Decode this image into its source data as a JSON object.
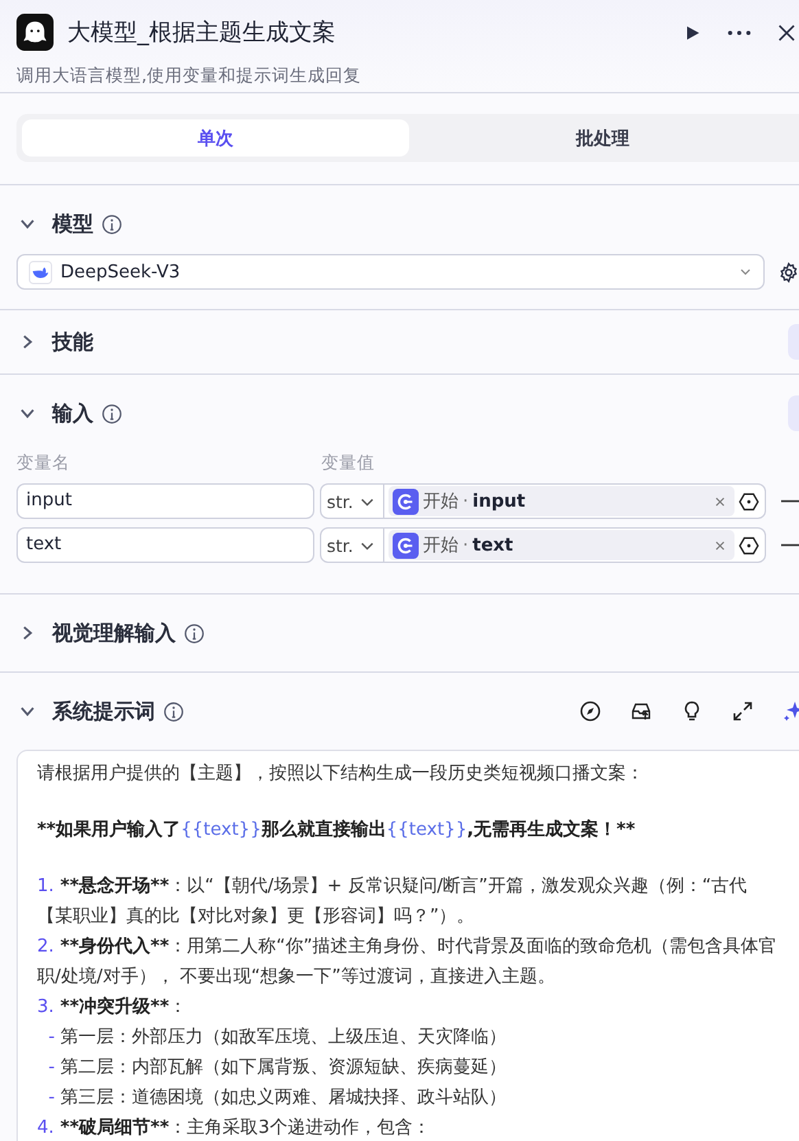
{
  "header": {
    "title": "大模型_根据主题生成文案",
    "subtitle": "调用大语言模型,使用变量和提示词生成回复"
  },
  "tabs": [
    {
      "label": "单次",
      "selected": true
    },
    {
      "label": "批处理",
      "selected": false
    }
  ],
  "model": {
    "title": "模型",
    "expanded": true,
    "value": "DeepSeek-V3"
  },
  "skills": {
    "title": "技能",
    "expanded": false
  },
  "inputs": {
    "title": "输入",
    "expanded": true,
    "name_header": "变量名",
    "value_header": "变量值",
    "rows": [
      {
        "name": "input",
        "type": "str.",
        "source": "开始",
        "separator": "·",
        "variable": "input"
      },
      {
        "name": "text",
        "type": "str.",
        "source": "开始",
        "separator": "·",
        "variable": "text"
      }
    ]
  },
  "vision": {
    "title": "视觉理解输入",
    "expanded": false
  },
  "system_prompt": {
    "title": "系统提示词",
    "expanded": true,
    "lines": [
      [
        {
          "kind": "plain",
          "text": "请根据用户提供的【主题】，按照以下结构生成一段历史类短视频口播文案："
        }
      ],
      [
        {
          "kind": "gap"
        }
      ],
      [
        {
          "kind": "bold",
          "text": "**如果用户输入了"
        },
        {
          "kind": "var",
          "text": "{{text}}"
        },
        {
          "kind": "bold",
          "text": "那么就直接输出"
        },
        {
          "kind": "var",
          "text": "{{text}}"
        },
        {
          "kind": "bold",
          "text": ",无需再生成文案！**"
        }
      ],
      [
        {
          "kind": "gap"
        }
      ],
      [
        {
          "kind": "num",
          "text": "1."
        },
        {
          "kind": "bold",
          "text": " **悬念开场**"
        },
        {
          "kind": "plain",
          "text": "：以“【朝代/场景】+ 反常识疑问/断言”开篇，激发观众兴趣（例：“古代【某职业】真的比【对比对象】更【形容词】吗？”）。"
        }
      ],
      [
        {
          "kind": "num",
          "text": "2."
        },
        {
          "kind": "bold",
          "text": " **身份代入**"
        },
        {
          "kind": "plain",
          "text": "：用第二人称“你”描述主角身份、时代背景及面临的致命危机（需包含具体官职/处境/对手）， 不要出现“想象一下”等过渡词，直接进入主题。"
        }
      ],
      [
        {
          "kind": "num",
          "text": "3."
        },
        {
          "kind": "bold",
          "text": " **冲突升级**"
        },
        {
          "kind": "plain",
          "text": "："
        }
      ],
      [
        {
          "kind": "dash",
          "text": "  - "
        },
        {
          "kind": "plain",
          "text": "第一层：外部压力（如敌军压境、上级压迫、天灾降临）"
        }
      ],
      [
        {
          "kind": "dash",
          "text": "  - "
        },
        {
          "kind": "plain",
          "text": "第二层：内部瓦解（如下属背叛、资源短缺、疾病蔓延）"
        }
      ],
      [
        {
          "kind": "dash",
          "text": "  - "
        },
        {
          "kind": "plain",
          "text": "第三层：道德困境（如忠义两难、屠城抉择、政斗站队）"
        }
      ],
      [
        {
          "kind": "num",
          "text": "4."
        },
        {
          "kind": "bold",
          "text": " **破局细节**"
        },
        {
          "kind": "plain",
          "text": "：主角采取3个递进动作，包含："
        }
      ]
    ]
  }
}
